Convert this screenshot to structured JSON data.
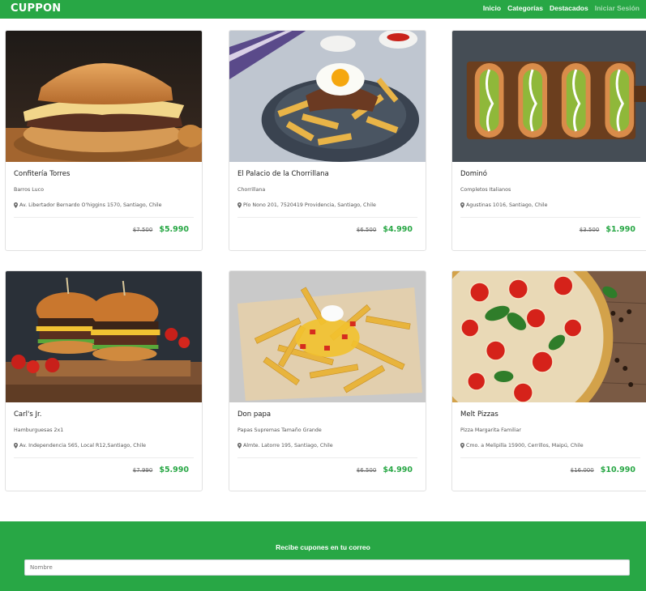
{
  "brand": "CUPPON",
  "nav": {
    "links": [
      "Inicio",
      "Categorías",
      "Destacados",
      "Iniciar Sesión"
    ]
  },
  "cards": [
    {
      "title": "Confitería Torres",
      "subtitle": "Barros Luco",
      "address": "Av. Libertador Bernardo O'higgins 1570, Santiago, Chile",
      "old_price": "$7.500",
      "new_price": "$5.990",
      "image": "burger-sandwich"
    },
    {
      "title": "El Palacio de la Chorrillana",
      "subtitle": "Chorrillana",
      "address": "Pío Nono 201, 7520419 Providencia, Santiago, Chile",
      "old_price": "$6.500",
      "new_price": "$4.990",
      "image": "chorrillana"
    },
    {
      "title": "Dominó",
      "subtitle": "Completos Italianos",
      "address": "Agustinas 1016, Santiago, Chile",
      "old_price": "$3.500",
      "new_price": "$1.990",
      "image": "hotdogs"
    },
    {
      "title": "Carl's Jr.",
      "subtitle": "Hamburguesas 2x1",
      "address": "Av. Independencia 565, Local R12,Santiago, Chile",
      "old_price": "$7.990",
      "new_price": "$5.990",
      "image": "burgers"
    },
    {
      "title": "Don papa",
      "subtitle": "Papas Supremas Tamaño Grande",
      "address": "Almte. Latorre 195, Santiago, Chile",
      "old_price": "$6.500",
      "new_price": "$4.990",
      "image": "fries"
    },
    {
      "title": "Melt Pizzas",
      "subtitle": "Pizza Margarita Familiar",
      "address": "Cmo. a Melipilla 15900, Cerrillos, Maipú, Chile",
      "old_price": "$16.000",
      "new_price": "$10.990",
      "image": "pizza"
    }
  ],
  "footer": {
    "title": "Recibe cupones en tu correo",
    "name_placeholder": "Nombre"
  },
  "colors": {
    "brand_green": "#28a745"
  },
  "icons": {
    "address": "map-marker-icon"
  }
}
